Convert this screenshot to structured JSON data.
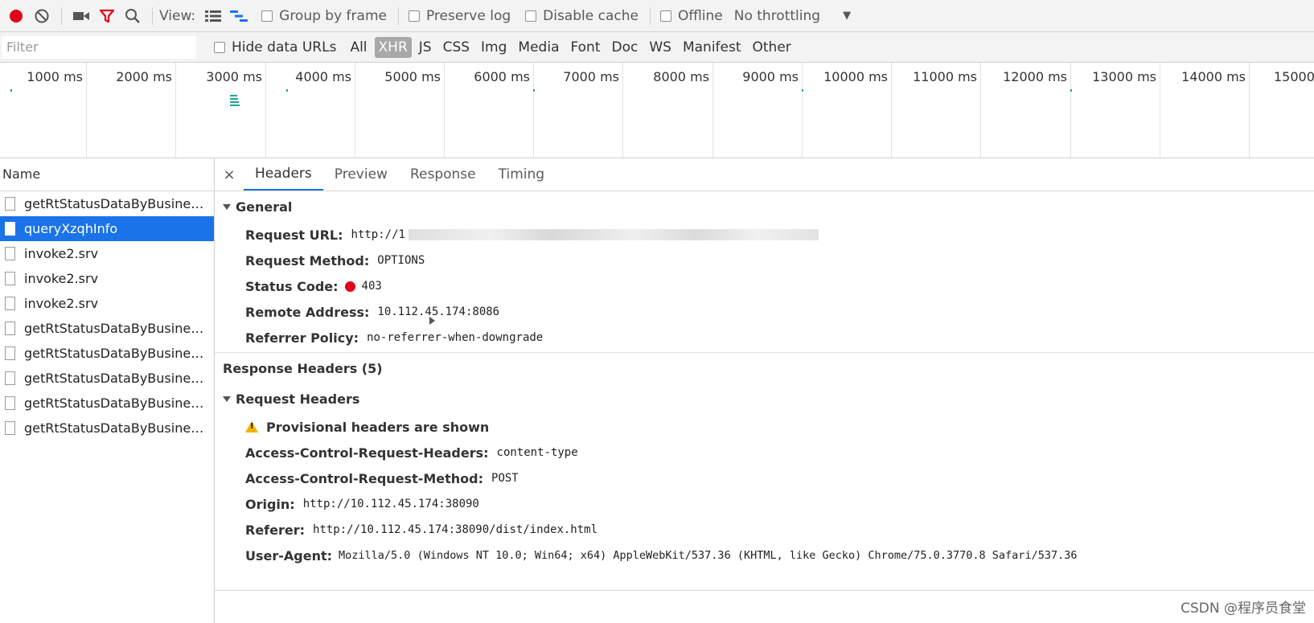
{
  "toolbar": {
    "icons": [
      "record-icon",
      "clear-icon",
      "camera-icon",
      "filter-icon",
      "search-icon"
    ],
    "view_label": "View:",
    "group_by_frame": "Group by frame",
    "preserve_log": "Preserve log",
    "disable_cache": "Disable cache",
    "offline": "Offline",
    "throttling": "No throttling",
    "colors": {
      "record": "#e0001a",
      "filter": "#e0001a"
    }
  },
  "filterbar": {
    "placeholder": "Filter",
    "hide_data_urls": "Hide data URLs",
    "types": [
      "All",
      "XHR",
      "JS",
      "CSS",
      "Img",
      "Media",
      "Font",
      "Doc",
      "WS",
      "Manifest",
      "Other"
    ],
    "active_type": "XHR"
  },
  "timeline": {
    "ticks": [
      "1000 ms",
      "2000 ms",
      "3000 ms",
      "4000 ms",
      "5000 ms",
      "6000 ms",
      "7000 ms",
      "8000 ms",
      "9000 ms",
      "10000 ms",
      "11000 ms",
      "12000 ms",
      "13000 ms",
      "14000 ms",
      "15000"
    ]
  },
  "requests": {
    "header": "Name",
    "items": [
      "getRtStatusDataByBusiness...",
      "queryXzqhInfo",
      "invoke2.srv",
      "invoke2.srv",
      "invoke2.srv",
      "getRtStatusDataByBusiness...",
      "getRtStatusDataByBusiness...",
      "getRtStatusDataByBusiness...",
      "getRtStatusDataByBusiness...",
      "getRtStatusDataByBusiness..."
    ],
    "selected_index": 1
  },
  "details": {
    "close": "×",
    "tabs": [
      "Headers",
      "Preview",
      "Response",
      "Timing"
    ],
    "active_tab": "Headers",
    "general": {
      "title": "General",
      "request_url_key": "Request URL:",
      "request_url_value": "http://1",
      "request_method_key": "Request Method:",
      "request_method_value": "OPTIONS",
      "status_code_key": "Status Code:",
      "status_code_value": "403",
      "remote_address_key": "Remote Address:",
      "remote_address_value": "10.112.45.174:8086",
      "referrer_policy_key": "Referrer Policy:",
      "referrer_policy_value": "no-referrer-when-downgrade"
    },
    "response_headers": {
      "title": "Response Headers (5)"
    },
    "request_headers": {
      "title": "Request Headers",
      "provisional": "Provisional headers are shown",
      "acrh_key": "Access-Control-Request-Headers:",
      "acrh_value": "content-type",
      "acrm_key": "Access-Control-Request-Method:",
      "acrm_value": "POST",
      "origin_key": "Origin:",
      "origin_value": "http://10.112.45.174:38090",
      "referer_key": "Referer:",
      "referer_value": "http://10.112.45.174:38090/dist/index.html",
      "ua_key": "User-Agent:",
      "ua_value": "Mozilla/5.0 (Windows NT 10.0; Win64; x64) AppleWebKit/537.36 (KHTML, like Gecko) Chrome/75.0.3770.8 Safari/537.36"
    }
  },
  "watermark": "CSDN @程序员食堂"
}
